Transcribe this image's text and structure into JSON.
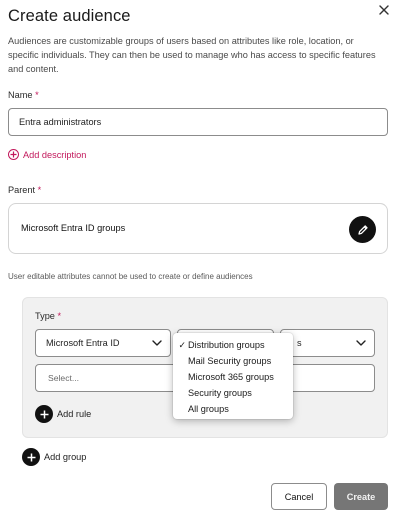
{
  "dialog": {
    "title": "Create audience",
    "description": "Audiences are customizable groups of users based on attributes like role, location, or specific individuals. They can then be used to manage who has access to specific features and content."
  },
  "name_field": {
    "label": "Name",
    "required_marker": "*",
    "value": "Entra administrators"
  },
  "add_description": {
    "label": "Add description"
  },
  "parent": {
    "label": "Parent",
    "required_marker": "*",
    "value": "Microsoft Entra ID groups"
  },
  "note": "User editable attributes cannot be used to create or define audiences",
  "rule": {
    "type_label": "Type",
    "required_marker": "*",
    "type_select": "Microsoft Entra ID",
    "third_select_fragment": "s",
    "select_placeholder": "Select...",
    "add_rule_label": "Add rule"
  },
  "dropdown": {
    "options": [
      {
        "label": "Distribution groups",
        "checked": true
      },
      {
        "label": "Mail Security groups",
        "checked": false
      },
      {
        "label": "Microsoft 365 groups",
        "checked": false
      },
      {
        "label": "Security groups",
        "checked": false
      },
      {
        "label": "All groups",
        "checked": false
      }
    ],
    "check_glyph": "✓"
  },
  "add_group_label": "Add group",
  "footer": {
    "cancel_label": "Cancel",
    "create_label": "Create"
  },
  "colors": {
    "accent": "#c2185b",
    "primary_disabled": "#767676",
    "panel_bg": "#f1f1f1"
  },
  "icons": {
    "close": "close-icon",
    "edit": "pencil-icon",
    "add_description": "plus-circle-outline-icon",
    "add": "plus-circle-filled-icon",
    "chevron": "chevron-down-icon"
  }
}
